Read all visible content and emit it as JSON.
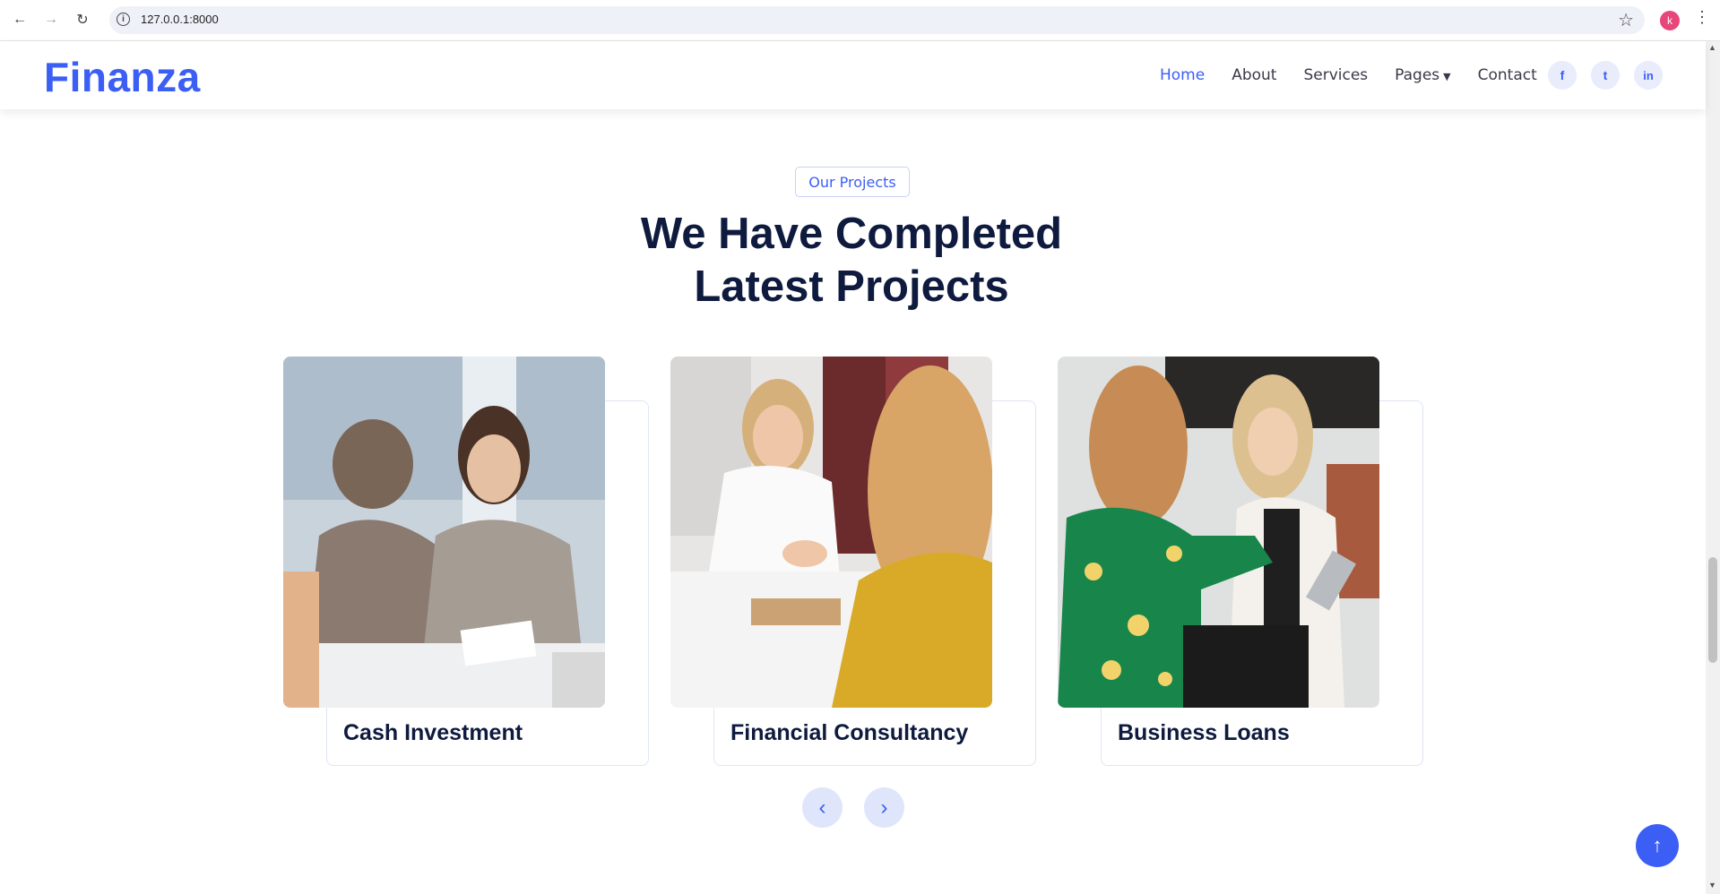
{
  "browser": {
    "url": "127.0.0.1:8000",
    "profile_initial": "k",
    "back_icon": "←",
    "forward_icon": "→",
    "reload_icon": "↻",
    "star_icon": "☆",
    "menu_icon": "⋮"
  },
  "header": {
    "logo": "Finanza",
    "nav": [
      {
        "label": "Home",
        "active": true
      },
      {
        "label": "About"
      },
      {
        "label": "Services"
      },
      {
        "label": "Pages",
        "has_dropdown": true
      },
      {
        "label": "Contact"
      }
    ],
    "social": [
      {
        "icon": "facebook-icon",
        "glyph": "f"
      },
      {
        "icon": "twitter-icon",
        "glyph": "t"
      },
      {
        "icon": "linkedin-icon",
        "glyph": "in"
      }
    ]
  },
  "section": {
    "tag": "Our Projects",
    "title_line1": "We Have Completed",
    "title_line2": "Latest Projects"
  },
  "projects": [
    {
      "title": "Cash Investment"
    },
    {
      "title": "Financial Consultancy"
    },
    {
      "title": "Business Loans"
    }
  ],
  "carousel": {
    "prev_icon": "‹",
    "next_icon": "›"
  },
  "back_to_top_icon": "↑",
  "colors": {
    "accent": "#3b5ef5",
    "heading": "#0e1a3e"
  }
}
